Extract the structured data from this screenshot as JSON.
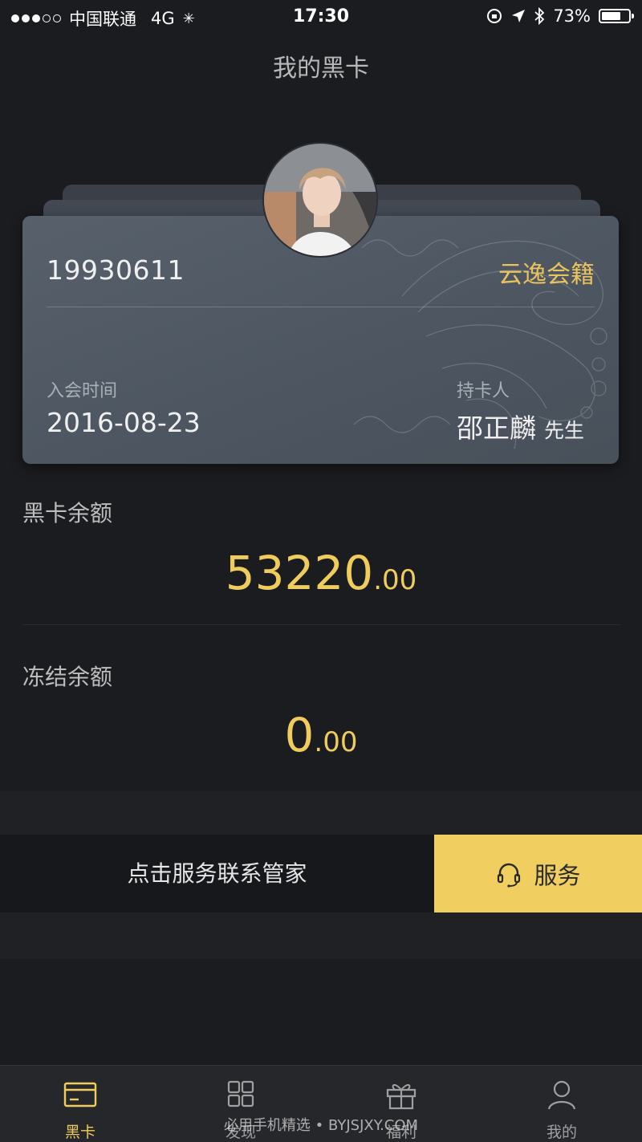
{
  "status_bar": {
    "carrier": "中国联通",
    "network": "4G",
    "time": "17:30",
    "battery": "73%",
    "battery_level": 0.73
  },
  "page_title": "我的黑卡",
  "card": {
    "number": "19930611",
    "tier": "云逸会籍",
    "join_label": "入会时间",
    "join_date": "2016-08-23",
    "holder_label": "持卡人",
    "holder_name": "邵正麟",
    "holder_title": "先生"
  },
  "balance": {
    "label": "黑卡余额",
    "integer": "53220",
    "decimal": ".00"
  },
  "frozen": {
    "label": "冻结余额",
    "integer": "0",
    "decimal": ".00"
  },
  "service": {
    "prompt": "点击服务联系管家",
    "button_label": "服务"
  },
  "tabs": [
    {
      "label": "黑卡",
      "icon": "card-icon",
      "active": true
    },
    {
      "label": "发现",
      "icon": "grid-icon",
      "active": false
    },
    {
      "label": "福利",
      "icon": "gift-icon",
      "active": false
    },
    {
      "label": "我的",
      "icon": "person-icon",
      "active": false
    }
  ],
  "watermark": "必用手机精选 • BYJSJXY.COM",
  "colors": {
    "accent": "#efcc5c",
    "background": "#1b1c20",
    "card": "#525b66",
    "service_button": "#f0cf60"
  }
}
